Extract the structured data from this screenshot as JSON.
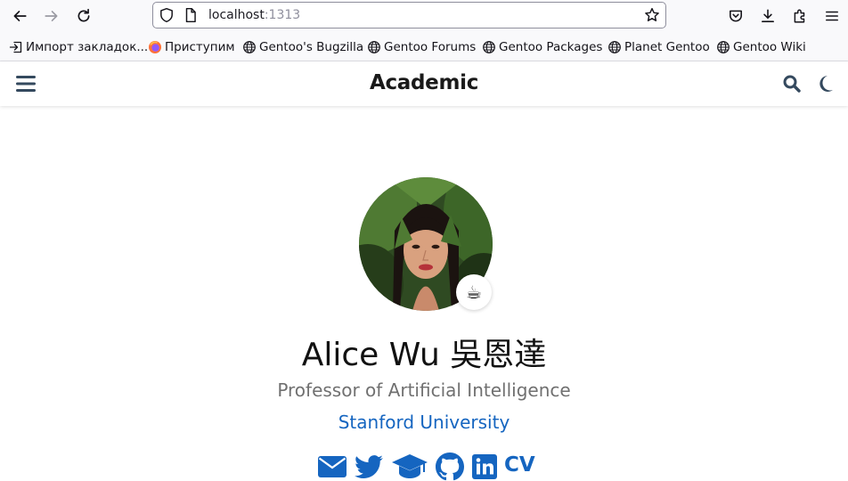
{
  "browser": {
    "url_host": "localhost",
    "url_port": ":1313",
    "bookmarks": [
      {
        "label": "Импорт закладок...",
        "icon": "import-icon"
      },
      {
        "label": "Приступим",
        "icon": "firefox-icon"
      },
      {
        "label": "Gentoo's Bugzilla",
        "icon": "globe-icon"
      },
      {
        "label": "Gentoo Forums",
        "icon": "globe-icon"
      },
      {
        "label": "Gentoo Packages",
        "icon": "globe-icon"
      },
      {
        "label": "Planet Gentoo",
        "icon": "globe-icon"
      },
      {
        "label": "Gentoo Wiki",
        "icon": "globe-icon"
      }
    ]
  },
  "navbar": {
    "brand": "Academic",
    "icons": [
      "menu-icon",
      "search-icon",
      "moon-icon"
    ]
  },
  "profile": {
    "status_emoji": "☕",
    "name": "Alice Wu 吳恩達",
    "role": "Professor of Artificial Intelligence",
    "organization": "Stanford University",
    "social_icons": [
      "envelope-icon",
      "twitter-icon",
      "graduation-cap-icon",
      "github-icon",
      "linkedin-icon"
    ],
    "cv_label": "CV"
  },
  "colors": {
    "accent": "#1565c0",
    "chrome_bg": "#f9f9fb",
    "text_dark": "#111111",
    "text_muted": "#707070"
  }
}
